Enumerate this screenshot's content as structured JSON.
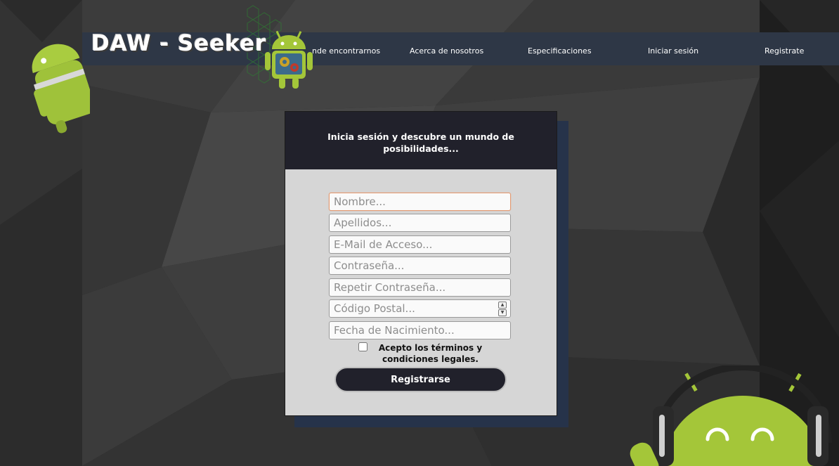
{
  "header": {
    "brand_logo": "DAW - Seeker",
    "nav": [
      {
        "label": "nde encontrarnos"
      },
      {
        "label": "Acerca de nosotros"
      },
      {
        "label": "Especificaciones"
      },
      {
        "label": "Iniciar sesión"
      },
      {
        "label": "Registrate"
      }
    ]
  },
  "card": {
    "title": "Inicia sesión y descubre un mundo de posibilidades...",
    "fields": [
      {
        "placeholder": "Nombre...",
        "value": "",
        "focused": true
      },
      {
        "placeholder": "Apellidos...",
        "value": ""
      },
      {
        "placeholder": "E-Mail de Acceso...",
        "value": ""
      },
      {
        "placeholder": "Contraseña...",
        "value": ""
      },
      {
        "placeholder": "Repetir Contraseña...",
        "value": ""
      },
      {
        "placeholder": "Código Postal...",
        "value": "",
        "type": "number"
      },
      {
        "placeholder": "Fecha de Nacimiento...",
        "value": ""
      }
    ],
    "terms_label": "Acepto los términos y condiciones legales.",
    "terms_checked": false,
    "submit_label": "Registrarse"
  },
  "decorations": {
    "left_mascot": "android-robot-icon",
    "logo_mascot": "android-gears-icon",
    "corner_mascot": "android-headphones-icon",
    "brand_pattern": "hexagon-pattern-icon"
  },
  "colors": {
    "navbar": "#2e3746",
    "card_header": "#21212b",
    "card_body": "#d6d6d6",
    "android_green": "#a4c639",
    "focus_border": "#e39a72"
  }
}
